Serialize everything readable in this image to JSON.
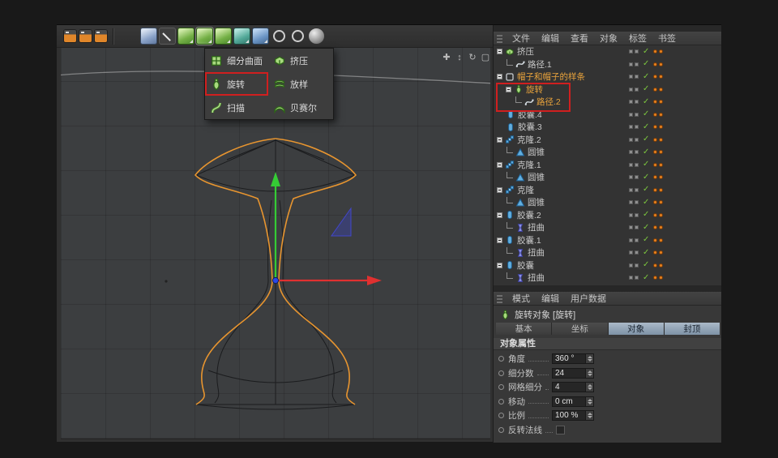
{
  "colors": {
    "annotation_red": "#d01f1f",
    "axis_x_red": "#e03030",
    "axis_y_green": "#35cc35",
    "axis_z_blue": "#2a48e8",
    "profile_spline_orange": "#e8952f",
    "tag_orange": "#e8831f",
    "check_green": "#7cc53e",
    "layer_text_orange": "#e8a33c"
  },
  "icons": {
    "check_glyph": "✓"
  },
  "toolbar": {
    "buttons": [
      {
        "name": "render-view",
        "style": "render"
      },
      {
        "name": "render-to-picture-viewer",
        "style": "render"
      },
      {
        "name": "render-settings",
        "style": "render"
      },
      {
        "name": "separator-1",
        "style": "sep"
      },
      {
        "name": "add-cube",
        "style": "cube"
      },
      {
        "name": "freehand-spline-pen",
        "style": "pen"
      },
      {
        "name": "subdivision-surface",
        "style": "green",
        "flyout": true
      },
      {
        "name": "generators",
        "style": "green",
        "flyout": true,
        "pressed": true
      },
      {
        "name": "deformers",
        "style": "green",
        "flyout": true
      },
      {
        "name": "spline-primitives",
        "style": "teal",
        "flyout": true
      },
      {
        "name": "mograph-objects",
        "style": "blue",
        "flyout": true
      },
      {
        "name": "camera",
        "style": "ring"
      },
      {
        "name": "light",
        "style": "ring"
      },
      {
        "name": "material-sphere",
        "style": "sphere"
      }
    ]
  },
  "viewport": {
    "nav_icons": [
      {
        "name": "pan",
        "glyph": "✚"
      },
      {
        "name": "dolly",
        "glyph": "↕"
      },
      {
        "name": "orbit",
        "glyph": "↻"
      },
      {
        "name": "toggle-view",
        "glyph": "▢"
      }
    ]
  },
  "generator_menu": {
    "items": [
      {
        "name": "subdivision-surface",
        "label": "细分曲面",
        "icon": "subdiv"
      },
      {
        "name": "extrude",
        "label": "挤压",
        "icon": "extrude"
      },
      {
        "name": "lathe",
        "label": "旋转",
        "icon": "lathe",
        "highlighted": true
      },
      {
        "name": "loft",
        "label": "放样",
        "icon": "loft"
      },
      {
        "name": "sweep",
        "label": "扫描",
        "icon": "sweep"
      },
      {
        "name": "bezier",
        "label": "贝赛尔",
        "icon": "bezier"
      }
    ]
  },
  "object_manager": {
    "menu": [
      "文件",
      "编辑",
      "查看",
      "对象",
      "标签",
      "书签"
    ],
    "items": [
      {
        "label": "挤压",
        "icon": "extrude",
        "depth": 0,
        "parent": true
      },
      {
        "label": "路径.1",
        "icon": "spline",
        "depth": 1
      },
      {
        "label": "帽子和帽子的样条",
        "icon": "group",
        "depth": 0,
        "parent": true,
        "text_color": "orange"
      },
      {
        "label": "旋转",
        "icon": "lathe",
        "depth": 1,
        "parent": true,
        "selected": true,
        "text_color": "orange"
      },
      {
        "label": "路径.2",
        "icon": "spline",
        "depth": 2,
        "text_color": "orange"
      },
      {
        "label": "胶囊.4",
        "icon": "capsule",
        "depth": 0
      },
      {
        "label": "胶囊.3",
        "icon": "capsule",
        "depth": 0
      },
      {
        "label": "克隆.2",
        "icon": "clone",
        "depth": 0,
        "parent": true
      },
      {
        "label": "圆锥",
        "icon": "cone",
        "depth": 1
      },
      {
        "label": "克隆.1",
        "icon": "clone",
        "depth": 0,
        "parent": true
      },
      {
        "label": "圆锥",
        "icon": "cone",
        "depth": 1
      },
      {
        "label": "克隆",
        "icon": "clone",
        "depth": 0,
        "parent": true
      },
      {
        "label": "圆锥",
        "icon": "cone",
        "depth": 1
      },
      {
        "label": "胶囊.2",
        "icon": "capsule",
        "depth": 0,
        "parent": true
      },
      {
        "label": "扭曲",
        "icon": "twist",
        "depth": 1
      },
      {
        "label": "胶囊.1",
        "icon": "capsule",
        "depth": 0,
        "parent": true
      },
      {
        "label": "扭曲",
        "icon": "twist",
        "depth": 1
      },
      {
        "label": "胶囊",
        "icon": "capsule",
        "depth": 0,
        "parent": true
      },
      {
        "label": "扭曲",
        "icon": "twist",
        "depth": 1
      }
    ]
  },
  "attribute_manager": {
    "menu": [
      "模式",
      "编辑",
      "用户数据"
    ],
    "title": "旋转对象 [旋转]",
    "tabs": [
      {
        "label": "基本",
        "active": false
      },
      {
        "label": "坐标",
        "active": false
      },
      {
        "label": "对象",
        "active": true
      },
      {
        "label": "封顶",
        "active": true
      }
    ],
    "section": "对象属性",
    "properties": [
      {
        "label": "角度",
        "value": "360 °",
        "type": "number"
      },
      {
        "label": "细分数",
        "value": "24",
        "type": "number"
      },
      {
        "label": "网格细分",
        "value": "4",
        "type": "number"
      },
      {
        "label": "移动",
        "value": "0 cm",
        "type": "number"
      },
      {
        "label": "比例",
        "value": "100 %",
        "type": "number"
      },
      {
        "label": "反转法线",
        "type": "checkbox",
        "checked": false
      }
    ]
  }
}
